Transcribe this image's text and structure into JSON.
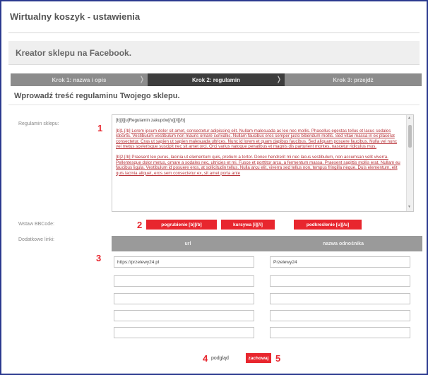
{
  "window": {
    "title": "Wirtualny koszyk - ustawienia"
  },
  "section": {
    "title": "Kreator sklepu na Facebook."
  },
  "steps": [
    {
      "label": "Krok 1: nazwa i opis",
      "active": false
    },
    {
      "label": "Krok 2: regulamin",
      "active": true
    },
    {
      "label": "Krok 3: przejdź",
      "active": false
    }
  ],
  "form": {
    "subtitle": "Wprowadź treść regulaminu Twojego sklepu.",
    "terms_label": "Regulamin sklepu:",
    "bbcode_label": "Wstaw BBCode:",
    "links_label": "Dodatkowe linki:",
    "terms_lines": [
      "[b][i][u]Regulamin zakupów[/u][/i][/b]",
      "[b]1.[/b] Lorem ipsum dolor sit amet, consectetur adipiscing elit. Nullam malesuada ac leo nec mollis. Phasellus egestas tellus et lacus sodales lobortis. Vestibulum vestibulum non mauris ornare convallis. Nullam faucibus eros semper justo bibendum mollis. Sed vitae massa in ex placerat consectetur. Cras ut sapien ut sapien malesuada ultrices. Nunc id lorem et quam dapibus faucibus. Sed aliquam posuere faucibus. Nulla vel nunc vel metus scelerisque suscipit nec sit amet orci. Orci varius natoque penatibus et magnis dis parturient montes, nascetur ridiculus mus.",
      "[b]2.[/b] Praesent leo purus, lacinia ut elementum quis, pretium a tortor. Donec hendrerit mi nec lacus vestibulum, non accumsan velit viverra. Pellentesque dolor metus, ornare a sodales nec, ultricies et mi. Fusce et porttitor arcu, a fermentum massa. Praesent sagittis mollis erat. Nullam eu faucibus ligula. Vestibulum id posuere eros, at sollicitudin tellus. Nulla arcu elit, viverra sed tellus non, tempus fringilla neque. Duis elementum, elit quis lacinia aliquet, eros sem consectetur ex, sit amet porta ante"
    ],
    "bbcode_buttons": [
      {
        "label": "pogrubienie [b][/b]"
      },
      {
        "label": "kursywa [i][/i]"
      },
      {
        "label": "podkreślenie [u][/u]"
      }
    ],
    "links_table": {
      "headers": [
        "url",
        "nazwa odnośnika"
      ],
      "rows": [
        {
          "url": "https://przelewy24.pl",
          "name": "Przelewy24"
        },
        {
          "url": "",
          "name": ""
        },
        {
          "url": "",
          "name": ""
        },
        {
          "url": "",
          "name": ""
        },
        {
          "url": "",
          "name": ""
        }
      ]
    },
    "preview_label": "podgląd",
    "save_label": "zachowaj"
  },
  "annotations": [
    "1",
    "2",
    "3",
    "4",
    "5"
  ],
  "colors": {
    "frame_border": "#2b3a8f",
    "accent_red": "#e8262e",
    "step_active": "#3d3d3d",
    "step_inactive": "#8c8c8c",
    "table_header": "#9a9a9a"
  }
}
